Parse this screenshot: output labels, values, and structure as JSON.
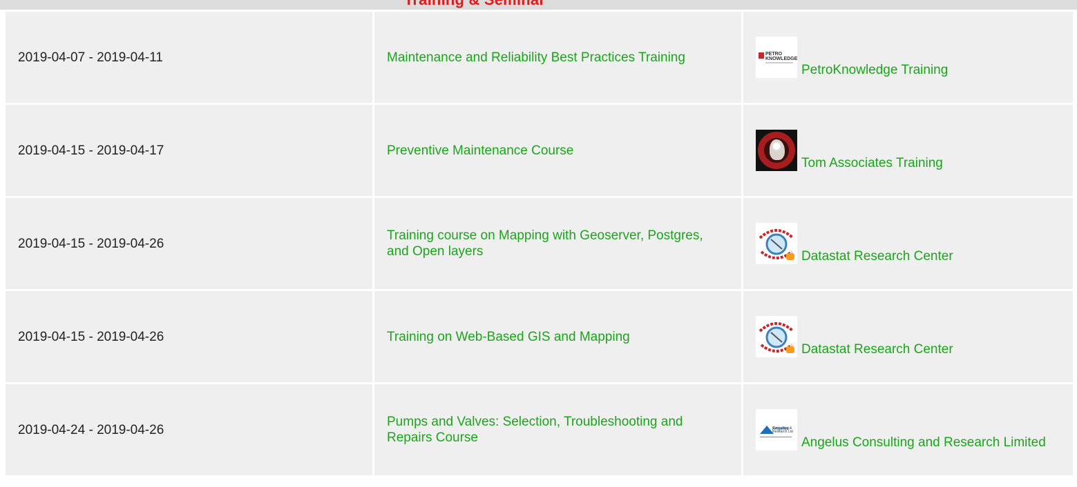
{
  "header": {
    "title": "Training & Seminar"
  },
  "table": {
    "rows": [
      {
        "date": "2019-04-07 - 2019-04-11",
        "course": "Maintenance and Reliability Best Practices Training",
        "provider": "PetroKnowledge Training",
        "logo": "petroknowledge-logo"
      },
      {
        "date": "2019-04-15 - 2019-04-17",
        "course": "Preventive Maintenance Course",
        "provider": "Tom Associates Training",
        "logo": "tom-associates-logo"
      },
      {
        "date": "2019-04-15 - 2019-04-26",
        "course": "Training course on Mapping with Geoserver, Postgres, and Open layers",
        "provider": "Datastat Research Center",
        "logo": "datastat-logo"
      },
      {
        "date": "2019-04-15 - 2019-04-26",
        "course": "Training on Web-Based GIS and Mapping",
        "provider": "Datastat Research Center",
        "logo": "datastat-logo"
      },
      {
        "date": "2019-04-24 - 2019-04-26",
        "course": "Pumps and Valves: Selection, Troubleshooting and Repairs Course",
        "provider": "Angelus Consulting and Research Limited",
        "logo": "angelus-logo"
      }
    ]
  },
  "colors": {
    "link": "#1aa51a",
    "header_title": "#e01b1b",
    "cell_bg": "#efefef"
  }
}
